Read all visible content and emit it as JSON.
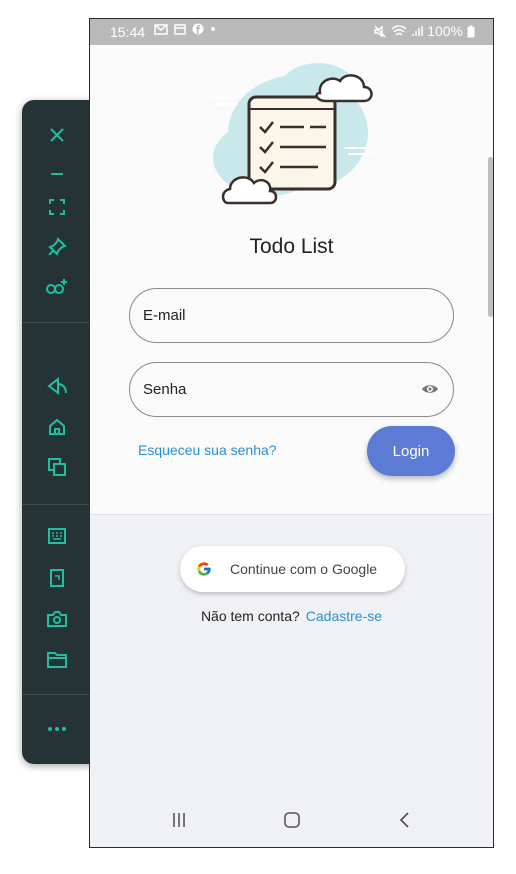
{
  "status_bar": {
    "time": "15:44",
    "battery": "100%"
  },
  "app": {
    "title": "Todo List",
    "email": {
      "placeholder": "E-mail",
      "value": ""
    },
    "password": {
      "placeholder": "Senha",
      "value": ""
    },
    "forgot_label": "Esqueceu sua senha?",
    "login_label": "Login",
    "google_label": "Continue com o Google",
    "no_account_text": "Não tem conta?",
    "signup_label": "Cadastre-se"
  },
  "toolbar": {
    "icons": [
      "close-icon",
      "minimize-icon",
      "fullscreen-icon",
      "pin-icon",
      "multi-display-icon",
      "back-icon",
      "home-icon",
      "overview-icon",
      "keyboard-icon",
      "rotate-icon",
      "camera-icon",
      "folder-icon",
      "more-icon"
    ]
  },
  "colors": {
    "accent": "#5b7bd5",
    "link": "#2a8fd6",
    "toolbar_icon": "#1fbf9f",
    "toolbar_bg": "#263336"
  }
}
